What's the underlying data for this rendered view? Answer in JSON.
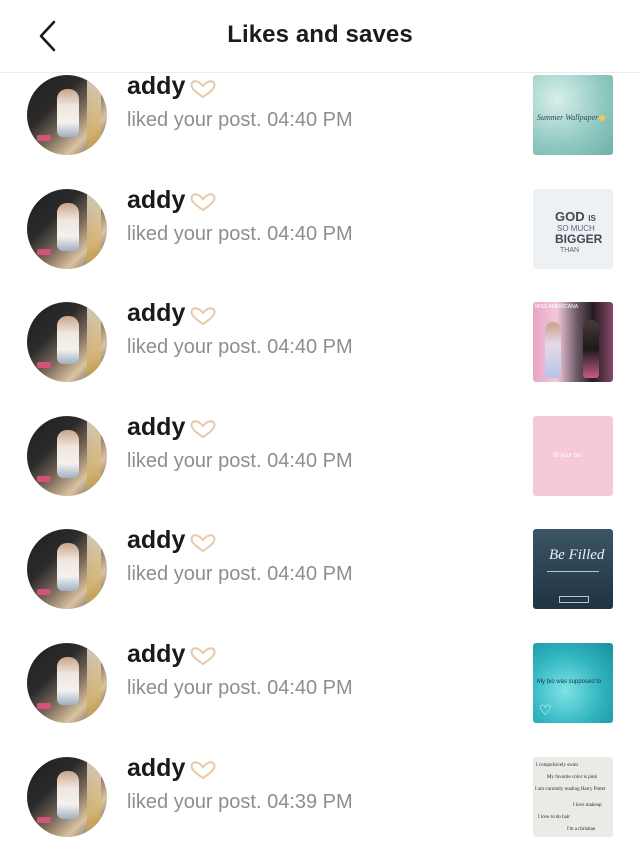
{
  "header": {
    "title": "Likes and saves",
    "back_icon": "chevron-left-icon"
  },
  "colors": {
    "name_text": "#1a1a1a",
    "meta_text": "#8e8e8e",
    "divider": "#ececec",
    "background": "#ffffff"
  },
  "notifications": [
    {
      "user": "addy",
      "emoji": "🫶",
      "message": "liked your post. 04:40 PM",
      "thumbnail": {
        "theme": "water",
        "text": "Summer Wallpaper"
      }
    },
    {
      "user": "addy",
      "emoji": "🫶",
      "message": "liked your post. 04:40 PM",
      "thumbnail": {
        "theme": "quote",
        "lines": [
          "GOD",
          "IS",
          "SO MUCH",
          "BIGGER",
          "THAN"
        ]
      }
    },
    {
      "user": "addy",
      "emoji": "🫶",
      "message": "liked your post. 04:40 PM",
      "thumbnail": {
        "theme": "collage",
        "text": "MISS AMERICANA"
      }
    },
    {
      "user": "addy",
      "emoji": "🫶",
      "message": "liked your post. 04:40 PM",
      "thumbnail": {
        "theme": "pink",
        "text": "fill your bio"
      }
    },
    {
      "user": "addy",
      "emoji": "🫶",
      "message": "liked your post. 04:40 PM",
      "thumbnail": {
        "theme": "blue",
        "text": "Be Filled"
      }
    },
    {
      "user": "addy",
      "emoji": "🫶",
      "message": "liked your post. 04:40 PM",
      "thumbnail": {
        "theme": "pool",
        "text": "My bio was supposed to"
      }
    },
    {
      "user": "addy",
      "emoji": "🫶",
      "message": "liked your post. 04:39 PM",
      "thumbnail": {
        "theme": "notes",
        "lines": [
          "I compulsively swim",
          "My favorite color is pink",
          "I am currently reading Harry Potter",
          "I love makeup",
          "I love to do hair",
          "I'm a christian"
        ]
      }
    }
  ]
}
